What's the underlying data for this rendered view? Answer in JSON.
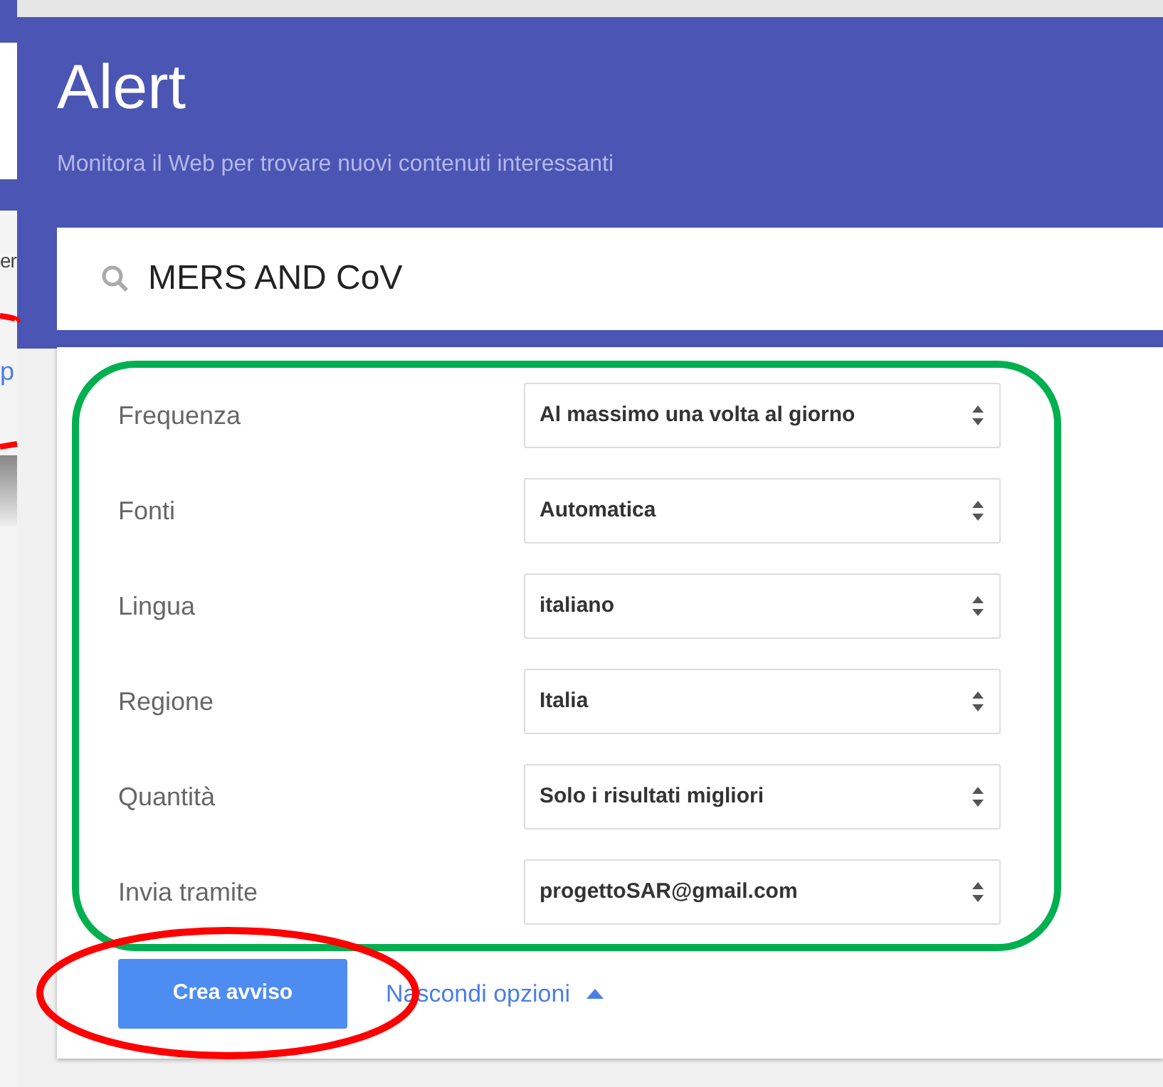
{
  "header": {
    "title": "Alert",
    "subtitle": "Monitora il Web per trovare nuovi contenuti interessanti"
  },
  "search": {
    "value": "MERS AND CoV"
  },
  "options": [
    {
      "label": "Frequenza",
      "value": "Al massimo una volta al giorno"
    },
    {
      "label": "Fonti",
      "value": "Automatica"
    },
    {
      "label": "Lingua",
      "value": "italiano"
    },
    {
      "label": "Regione",
      "value": "Italia"
    },
    {
      "label": "Quantità",
      "value": "Solo i risultati migliori"
    },
    {
      "label": "Invia tramite",
      "value": "progettoSAR@gmail.com"
    }
  ],
  "create_button": "Crea avviso",
  "toggle_link": {
    "label": "Nascondi opzioni",
    "expanded": true
  },
  "background_window": {
    "text_1": "er",
    "link_1": "p"
  }
}
